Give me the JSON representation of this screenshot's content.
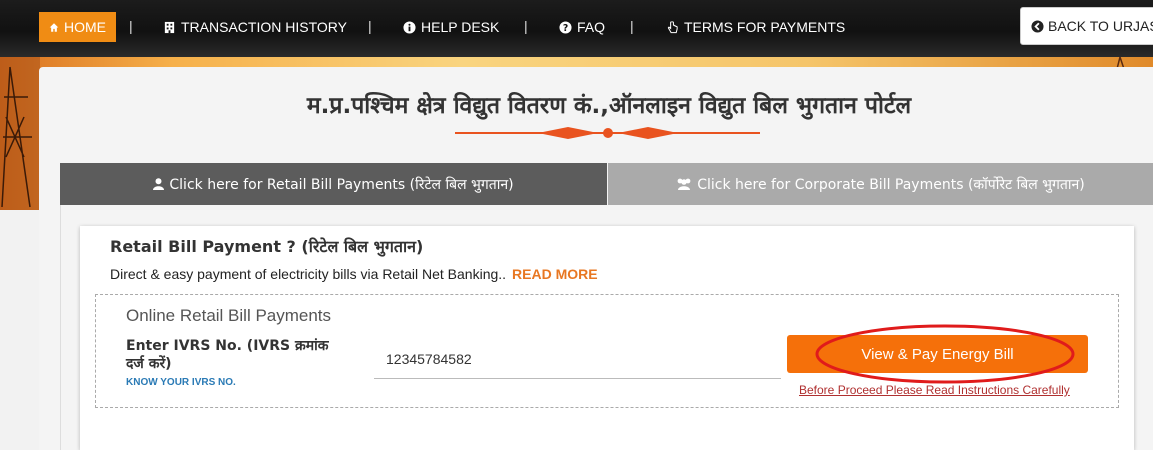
{
  "nav": {
    "home": "HOME",
    "transaction_history": "TRANSACTION HISTORY",
    "help_desk": "HELP DESK",
    "faq": "FAQ",
    "terms": "TERMS FOR PAYMENTS",
    "back": "BACK TO URJAS",
    "separator": "|"
  },
  "portal": {
    "title": "म.प्र.पश्चिम क्षेत्र विद्युत वितरण कं.,ऑनलाइन विद्युत बिल भुगतान पोर्टल"
  },
  "tabs": {
    "retail": "Click here for Retail Bill Payments (रिटेल बिल भुगतान)",
    "corporate": "Click here for Corporate Bill Payments (कॉर्पोरेट बिल भुगतान)"
  },
  "retail": {
    "heading": "Retail Bill Payment ? (रिटेल बिल भुगतान)",
    "description": "Direct & easy payment of electricity bills via Retail Net Banking..",
    "read_more": "READ MORE",
    "online_title": "Online Retail Bill Payments",
    "ivrs_label": "Enter IVRS No. (IVRS क्रमांक दर्ज करें)",
    "know_ivrs": "KNOW YOUR IVRS NO.",
    "ivrs_value": "12345784582",
    "pay_button": "View & Pay Energy Bill",
    "proceed_note": "Before Proceed Please Read Instructions Carefully"
  },
  "colors": {
    "accent": "#f08c14",
    "button": "#f5700a",
    "highlight_ring": "#e01b1b",
    "link": "#2a7ab5"
  }
}
